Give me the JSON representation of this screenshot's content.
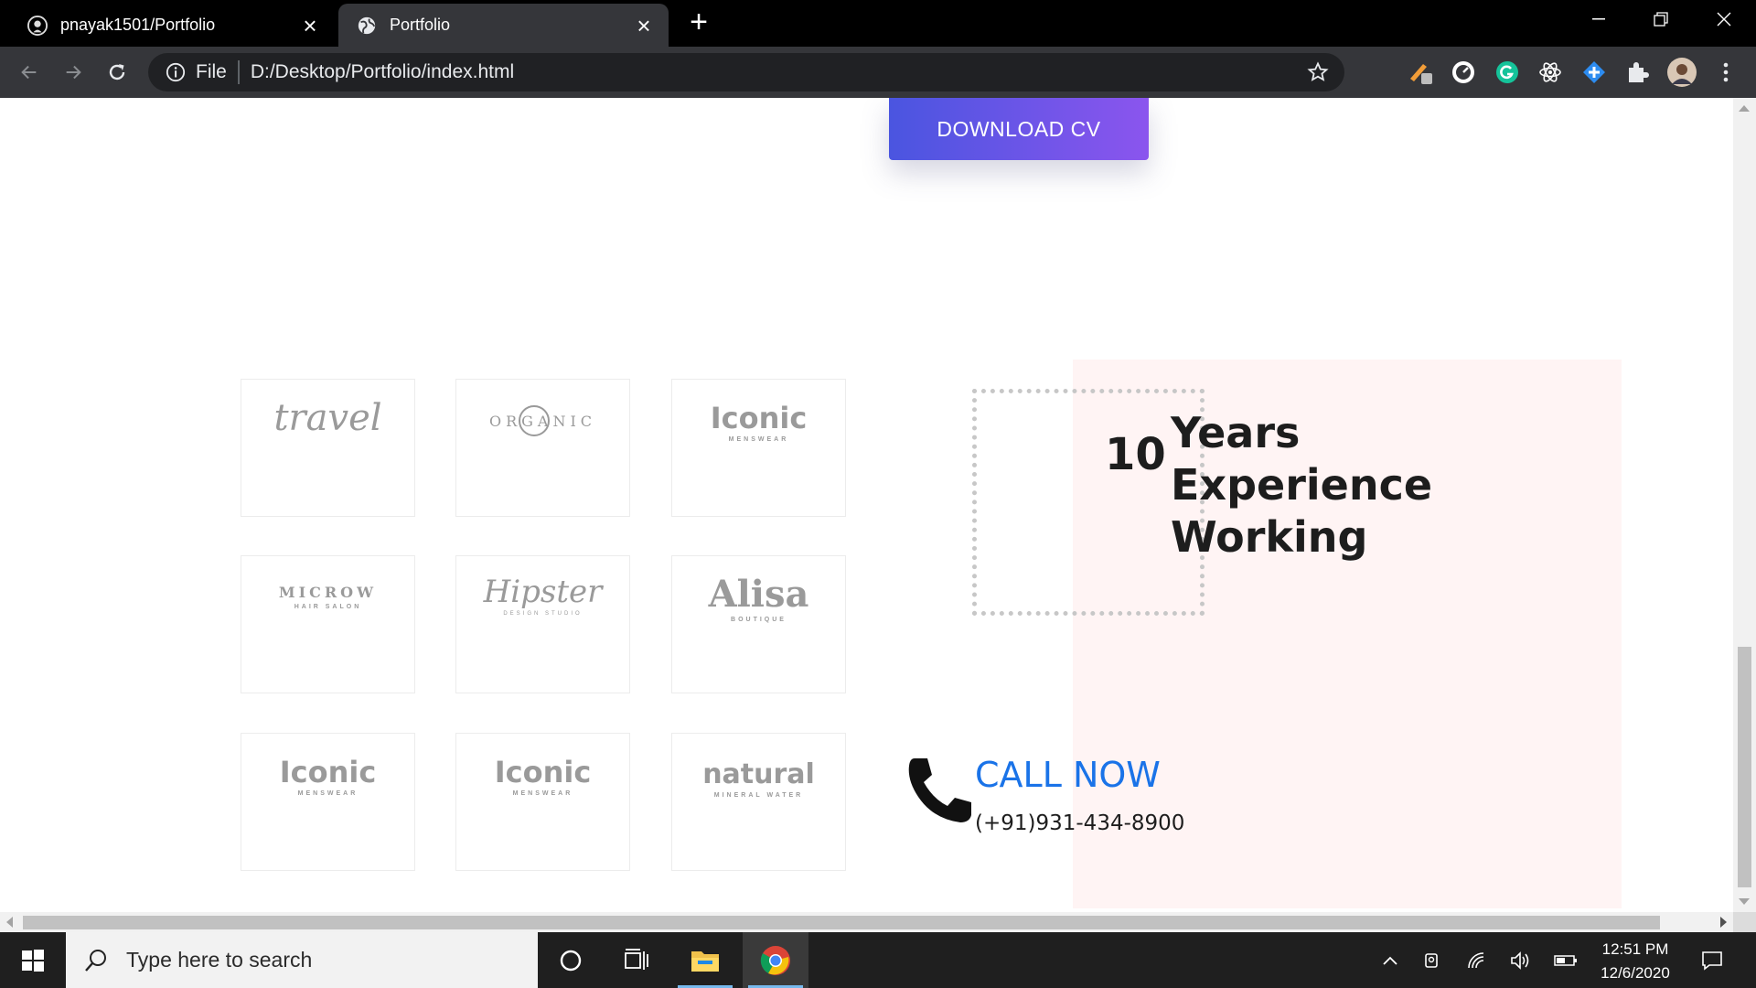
{
  "browser": {
    "tabs": [
      {
        "title": "pnayak1501/Portfolio",
        "active": false
      },
      {
        "title": "Portfolio",
        "active": true
      }
    ],
    "address": {
      "scheme_label": "File",
      "url": "D:/Desktop/Portfolio/index.html"
    }
  },
  "page": {
    "download_label": "DOWNLOAD CV",
    "logos": [
      {
        "name": "travel",
        "text": "travel",
        "sub": ""
      },
      {
        "name": "organic",
        "text": "ORGANIC",
        "sub": ""
      },
      {
        "name": "iconic",
        "text": "Iconic",
        "sub": "MENSWEAR"
      },
      {
        "name": "microw",
        "text": "MICROW",
        "sub": "HAIR SALON"
      },
      {
        "name": "hipster",
        "text": "Hipster",
        "sub": "DESIGN STUDIO"
      },
      {
        "name": "alisa",
        "text": "Alisa",
        "sub": "BOUTIQUE"
      },
      {
        "name": "iconic-2",
        "text": "Iconic",
        "sub": "MENSWEAR"
      },
      {
        "name": "iconic-3",
        "text": "Iconic",
        "sub": "MENSWEAR"
      },
      {
        "name": "natural",
        "text": "natural",
        "sub": "MINERAL WATER"
      }
    ],
    "experience": {
      "number": "10",
      "line1": "Years",
      "line2": "Experience",
      "line3": "Working"
    },
    "call": {
      "label": "CALL NOW",
      "number": "(+91)931-434-8900"
    },
    "colors": {
      "accent": "#1a73e8",
      "button_start": "#4a55e0",
      "button_end": "#8b55ee",
      "panel": "#fff4f4"
    }
  },
  "taskbar": {
    "search_placeholder": "Type here to search",
    "time": "12:51 PM",
    "date": "12/6/2020"
  }
}
